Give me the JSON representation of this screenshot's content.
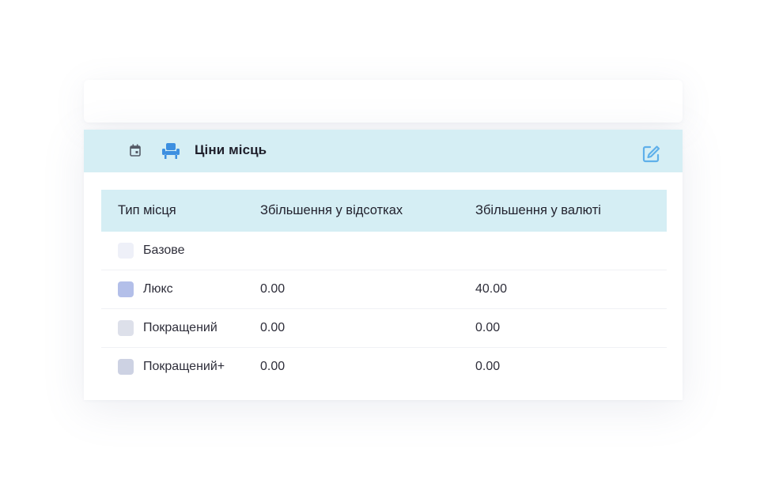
{
  "panel": {
    "title": "Ціни місць",
    "icons": {
      "calendar": "calendar-icon",
      "seat": "armchair-icon",
      "edit": "edit-icon"
    },
    "accent_color": "#4aa3e8",
    "header_bg": "#d5eef4"
  },
  "table": {
    "headers": [
      "Тип місця",
      "Збільшення у відсотках",
      "Збільшення у валюті"
    ],
    "rows": [
      {
        "type": "Базове",
        "percent": "",
        "currency": "",
        "color": "#eef0f8"
      },
      {
        "type": "Люкс",
        "percent": "0.00",
        "currency": "40.00",
        "color": "#b3bfe9"
      },
      {
        "type": "Покращений",
        "percent": "0.00",
        "currency": "0.00",
        "color": "#dde0ea"
      },
      {
        "type": "Покращений+",
        "percent": "0.00",
        "currency": "0.00",
        "color": "#cdd2e3"
      }
    ]
  }
}
